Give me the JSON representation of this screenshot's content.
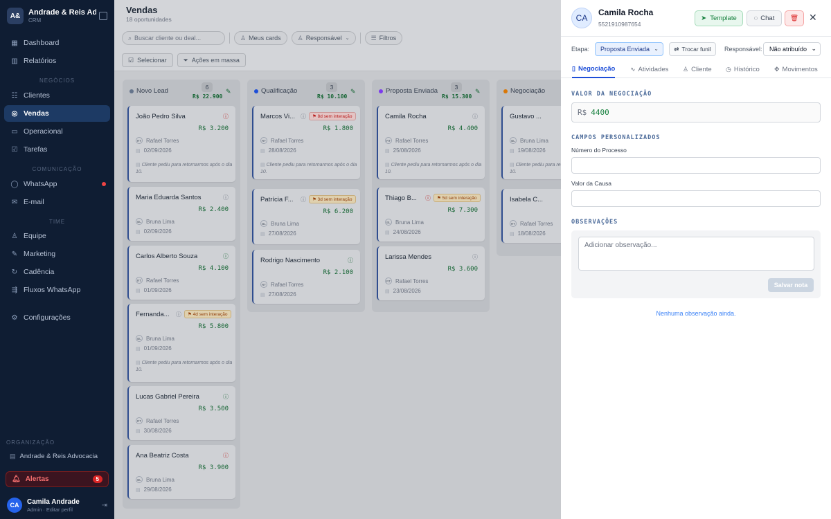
{
  "sidebar": {
    "brand": {
      "logo": "A&",
      "name": "Andrade & Reis Advc",
      "subtitle": "CRM"
    },
    "sections": {
      "negocios": "NEGÓCIOS",
      "comunicacao": "COMUNICAÇÃO",
      "time": "TIME"
    },
    "items": [
      {
        "label": "Dashboard",
        "icon": "grid-icon"
      },
      {
        "label": "Relatórios",
        "icon": "bar-chart-icon"
      },
      {
        "label": "Clientes",
        "icon": "users-icon"
      },
      {
        "label": "Vendas",
        "icon": "target-icon",
        "active": true
      },
      {
        "label": "Operacional",
        "icon": "briefcase-icon"
      },
      {
        "label": "Tarefas",
        "icon": "checkbox-icon"
      },
      {
        "label": "WhatsApp",
        "icon": "whatsapp-icon"
      },
      {
        "label": "E-mail",
        "icon": "mail-icon"
      },
      {
        "label": "Equipe",
        "icon": "user-icon"
      },
      {
        "label": "Marketing",
        "icon": "megaphone-icon"
      },
      {
        "label": "Cadência",
        "icon": "repeat-icon"
      },
      {
        "label": "Fluxos WhatsApp",
        "icon": "flow-icon"
      },
      {
        "label": "Configurações",
        "icon": "gear-icon"
      }
    ],
    "org_label": "ORGANIZAÇÃO",
    "org_name": "Andrade & Reis Advocacia",
    "alerts": {
      "label": "Alertas",
      "count": "5"
    },
    "user": {
      "initials": "CA",
      "name": "Camila Andrade",
      "role": "Admin · Editar perfil"
    }
  },
  "main": {
    "title": "Vendas",
    "subtitle": "18 oportunidades",
    "search_placeholder": "Buscar cliente ou deal...",
    "filters": {
      "my_cards": "Meus cards",
      "responsible": "Responsável",
      "filters": "Filtros"
    },
    "actions": {
      "select": "Selecionar",
      "bulk": "Ações em massa"
    },
    "columns": [
      {
        "name": "Novo Lead",
        "count": "6",
        "total": "R$ 22.900",
        "color": "#64748b",
        "cards": [
          {
            "name": "João Pedro Silva",
            "value": "R$ 3.200",
            "owner_initials": "RT",
            "owner": "Rafael Torres",
            "date": "02/09/2026",
            "note": "Cliente pediu para retornarmos após o dia 10.",
            "info_color": "#b91c1c"
          },
          {
            "name": "Maria Eduarda Santos",
            "value": "R$ 2.400",
            "owner_initials": "BL",
            "owner": "Bruna Lima",
            "date": "02/09/2026",
            "info_color": "#6b7280"
          },
          {
            "name": "Carlos Alberto Souza",
            "value": "R$ 4.100",
            "owner_initials": "RT",
            "owner": "Rafael Torres",
            "date": "01/09/2026",
            "info_color": "#166534"
          },
          {
            "name": "Fernanda...",
            "value": "R$ 5.800",
            "owner_initials": "BL",
            "owner": "Bruna Lima",
            "date": "01/09/2026",
            "tag": "4d sem interação",
            "tag_type": "amber",
            "note": "Cliente pediu para retornarmos após o dia 10.",
            "info_color": "#6b7280"
          },
          {
            "name": "Lucas Gabriel Pereira",
            "value": "R$ 3.500",
            "owner_initials": "RT",
            "owner": "Rafael Torres",
            "date": "30/08/2026",
            "info_color": "#166534"
          },
          {
            "name": "Ana Beatriz Costa",
            "value": "R$ 3.900",
            "owner_initials": "BL",
            "owner": "Bruna Lima",
            "date": "29/08/2026",
            "info_color": "#b91c1c"
          }
        ]
      },
      {
        "name": "Qualificação",
        "count": "3",
        "total": "R$ 10.100",
        "color": "#1d4ed8",
        "cards": [
          {
            "name": "Marcos Vi...",
            "value": "R$ 1.800",
            "owner_initials": "RT",
            "owner": "Rafael Torres",
            "date": "28/08/2026",
            "tag": "8d sem interação",
            "tag_type": "red",
            "note": "Cliente pediu para retornarmos após o dia 10.",
            "info_color": "#6b7280"
          },
          {
            "name": "Patrícia F...",
            "value": "R$ 6.200",
            "owner_initials": "BL",
            "owner": "Bruna Lima",
            "date": "27/08/2026",
            "tag": "3d sem interação",
            "tag_type": "amber",
            "info_color": "#6b7280"
          },
          {
            "name": "Rodrigo Nascimento",
            "value": "R$ 2.100",
            "owner_initials": "RT",
            "owner": "Rafael Torres",
            "date": "27/08/2026",
            "info_color": "#166534"
          }
        ]
      },
      {
        "name": "Proposta Enviada",
        "count": "3",
        "total": "R$ 15.300",
        "color": "#7c3aed",
        "cards": [
          {
            "name": "Camila Rocha",
            "value": "R$ 4.400",
            "owner_initials": "RT",
            "owner": "Rafael Torres",
            "date": "25/08/2026",
            "note": "Cliente pediu para retornarmos após o dia 10.",
            "info_color": "#6b7280"
          },
          {
            "name": "Thiago B...",
            "value": "R$ 7.300",
            "owner_initials": "BL",
            "owner": "Bruna Lima",
            "date": "24/08/2026",
            "tag": "5d sem interação",
            "tag_type": "amber",
            "info_color": "#b91c1c"
          },
          {
            "name": "Larissa Mendes",
            "value": "R$ 3.600",
            "owner_initials": "RT",
            "owner": "Rafael Torres",
            "date": "23/08/2026",
            "info_color": "#6b7280"
          }
        ]
      },
      {
        "name": "Negociação",
        "color": "#d97706",
        "cards": [
          {
            "name": "Gustavo ...",
            "owner_initials": "BL",
            "owner": "Bruna Lima",
            "date": "19/08/2026",
            "note": "Cliente pediu para retornarmos após o dia 10."
          },
          {
            "name": "Isabela C...",
            "owner_initials": "RT",
            "owner": "Rafael Torres",
            "date": "18/08/2026"
          }
        ]
      }
    ]
  },
  "panel": {
    "initials": "CA",
    "name": "Camila Rocha",
    "phone": "5521910987654",
    "buttons": {
      "template": "Template",
      "chat": "Chat"
    },
    "stage_label": "Etapa:",
    "stage_value": "Proposta Enviada",
    "switch_funnel": "Trocar funil",
    "responsible_label": "Responsável:",
    "responsible_value": "Não atribuído",
    "tabs": [
      {
        "label": "Negociação",
        "icon": "document-icon",
        "active": true
      },
      {
        "label": "Atividades",
        "icon": "activity-icon"
      },
      {
        "label": "Cliente",
        "icon": "user-icon"
      },
      {
        "label": "Histórico",
        "icon": "clock-icon"
      },
      {
        "label": "Movimentos",
        "icon": "move-icon"
      }
    ],
    "deal_value_title": "VALOR DA NEGOCIAÇÃO",
    "currency": "R$",
    "deal_value": "4400",
    "custom_fields_title": "CAMPOS PERSONALIZADOS",
    "field_process": "Número do Processo",
    "field_cause_value": "Valor da Causa",
    "notes_title": "OBSERVAÇÕES",
    "note_placeholder": "Adicionar observação...",
    "save_note": "Salvar nota",
    "no_notes": "Nenhuma observação ainda."
  }
}
